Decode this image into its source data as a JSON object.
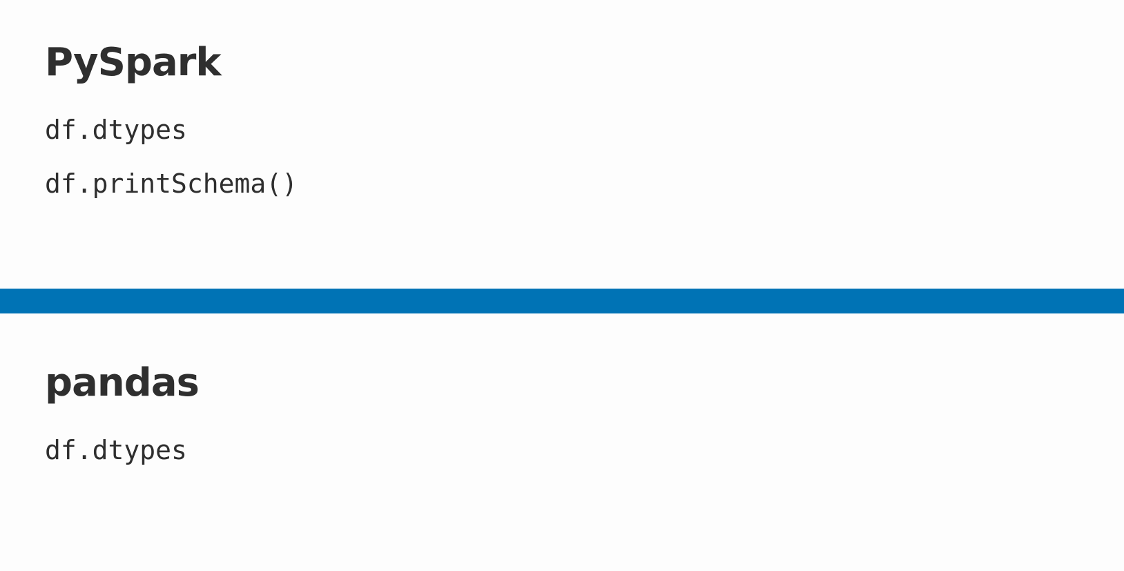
{
  "pyspark": {
    "heading": "PySpark",
    "lines": [
      "df.dtypes",
      "df.printSchema()"
    ]
  },
  "pandas": {
    "heading": "pandas",
    "lines": [
      "df.dtypes"
    ]
  },
  "colors": {
    "divider": "#0073b5",
    "text": "#2f2f2f",
    "background": "#fdfdfd"
  }
}
